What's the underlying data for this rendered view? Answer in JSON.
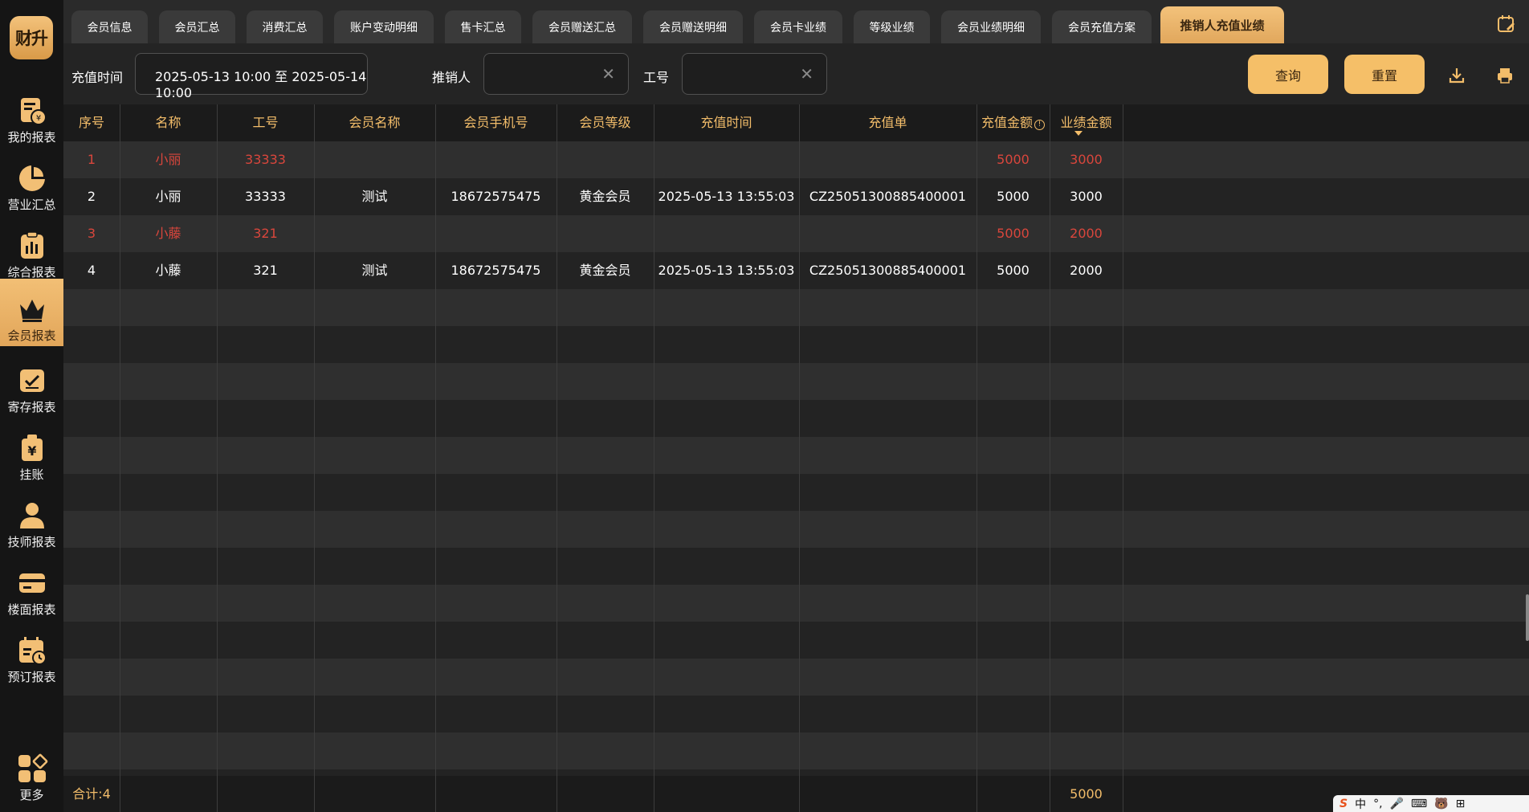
{
  "app": {
    "logo_text": "财升"
  },
  "sidebar": {
    "items": [
      {
        "label": "我的报表",
        "icon": "report-yen-icon"
      },
      {
        "label": "营业汇总",
        "icon": "pie-chart-icon"
      },
      {
        "label": "综合报表",
        "icon": "clipboard-chart-icon"
      },
      {
        "label": "会员报表",
        "icon": "crown-icon",
        "active": true
      },
      {
        "label": "寄存报表",
        "icon": "storage-box-icon"
      },
      {
        "label": "挂账",
        "icon": "credit-bag-icon"
      },
      {
        "label": "技师报表",
        "icon": "person-icon"
      },
      {
        "label": "楼面报表",
        "icon": "card-icon"
      },
      {
        "label": "预订报表",
        "icon": "calendar-clock-icon"
      },
      {
        "label": "更多",
        "icon": "apps-grid-icon"
      }
    ]
  },
  "tabs": [
    {
      "label": "会员信息"
    },
    {
      "label": "会员汇总"
    },
    {
      "label": "消费汇总"
    },
    {
      "label": "账户变动明细"
    },
    {
      "label": "售卡汇总"
    },
    {
      "label": "会员赠送汇总"
    },
    {
      "label": "会员赠送明细"
    },
    {
      "label": "会员卡业绩"
    },
    {
      "label": "等级业绩"
    },
    {
      "label": "会员业绩明细"
    },
    {
      "label": "会员充值方案"
    },
    {
      "label": "推销人充值业绩",
      "active": true
    }
  ],
  "filters": {
    "time_label": "充值时间",
    "time_value": "2025-05-13 10:00 至 2025-05-14 10:00",
    "seller_label": "推销人",
    "seller_value": "",
    "staff_no_label": "工号",
    "staff_no_value": "",
    "query_button": "查询",
    "reset_button": "重置"
  },
  "table": {
    "columns": [
      "序号",
      "名称",
      "工号",
      "会员名称",
      "会员手机号",
      "会员等级",
      "充值时间",
      "充值单",
      "充值金额",
      "业绩金额"
    ],
    "rows": [
      {
        "seq": "1",
        "name": "小丽",
        "staff_no": "33333",
        "member_name": "",
        "phone": "",
        "level": "",
        "time": "",
        "order": "",
        "amount": "5000",
        "perf": "3000",
        "summary": true
      },
      {
        "seq": "2",
        "name": "小丽",
        "staff_no": "33333",
        "member_name": "测试",
        "phone": "18672575475",
        "level": "黄金会员",
        "time": "2025-05-13 13:55:03",
        "order": "CZ25051300885400001",
        "amount": "5000",
        "perf": "3000",
        "summary": false
      },
      {
        "seq": "3",
        "name": "小藤",
        "staff_no": "321",
        "member_name": "",
        "phone": "",
        "level": "",
        "time": "",
        "order": "",
        "amount": "5000",
        "perf": "2000",
        "summary": true
      },
      {
        "seq": "4",
        "name": "小藤",
        "staff_no": "321",
        "member_name": "测试",
        "phone": "18672575475",
        "level": "黄金会员",
        "time": "2025-05-13 13:55:03",
        "order": "CZ25051300885400001",
        "amount": "5000",
        "perf": "2000",
        "summary": false
      }
    ],
    "footer": {
      "total_label": "合计:4",
      "perf_total": "5000"
    }
  },
  "ime": {
    "items": [
      "中",
      "°,",
      "🎤",
      "⌨",
      "🐻",
      "⊞"
    ]
  },
  "colors": {
    "accent": "#f5bf68",
    "summary_red": "#d9463c",
    "header_text": "#f3bd6a"
  }
}
